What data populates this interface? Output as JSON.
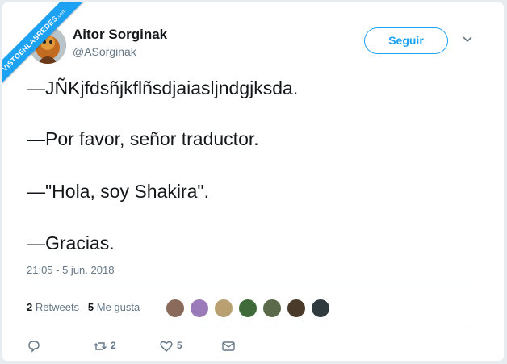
{
  "watermark": {
    "text": "VISTOENLASREDES",
    "suffix": ".com"
  },
  "author": {
    "name": "Aitor Sorginak",
    "handle": "@ASorginak"
  },
  "header": {
    "follow_label": "Seguir",
    "more_icon": "chevron-down-icon"
  },
  "tweet": {
    "lines": [
      "—JÑKjfdsñjkflñsdjaiasljndgjksda.",
      "—Por favor, señor traductor.",
      "—\"Hola, soy Shakira\".",
      "—Gracias."
    ],
    "timestamp": "21:05 - 5 jun. 2018"
  },
  "stats": {
    "retweets_count": "2",
    "retweets_label": "Retweets",
    "likes_count": "5",
    "likes_label": "Me gusta"
  },
  "actions": {
    "reply_icon": "reply-icon",
    "retweet_icon": "retweet-icon",
    "retweet_count": "2",
    "like_icon": "heart-icon",
    "like_count": "5",
    "message_icon": "envelope-icon"
  },
  "colors": {
    "accent": "#1da1f2",
    "text": "#14171a",
    "muted": "#657786"
  }
}
